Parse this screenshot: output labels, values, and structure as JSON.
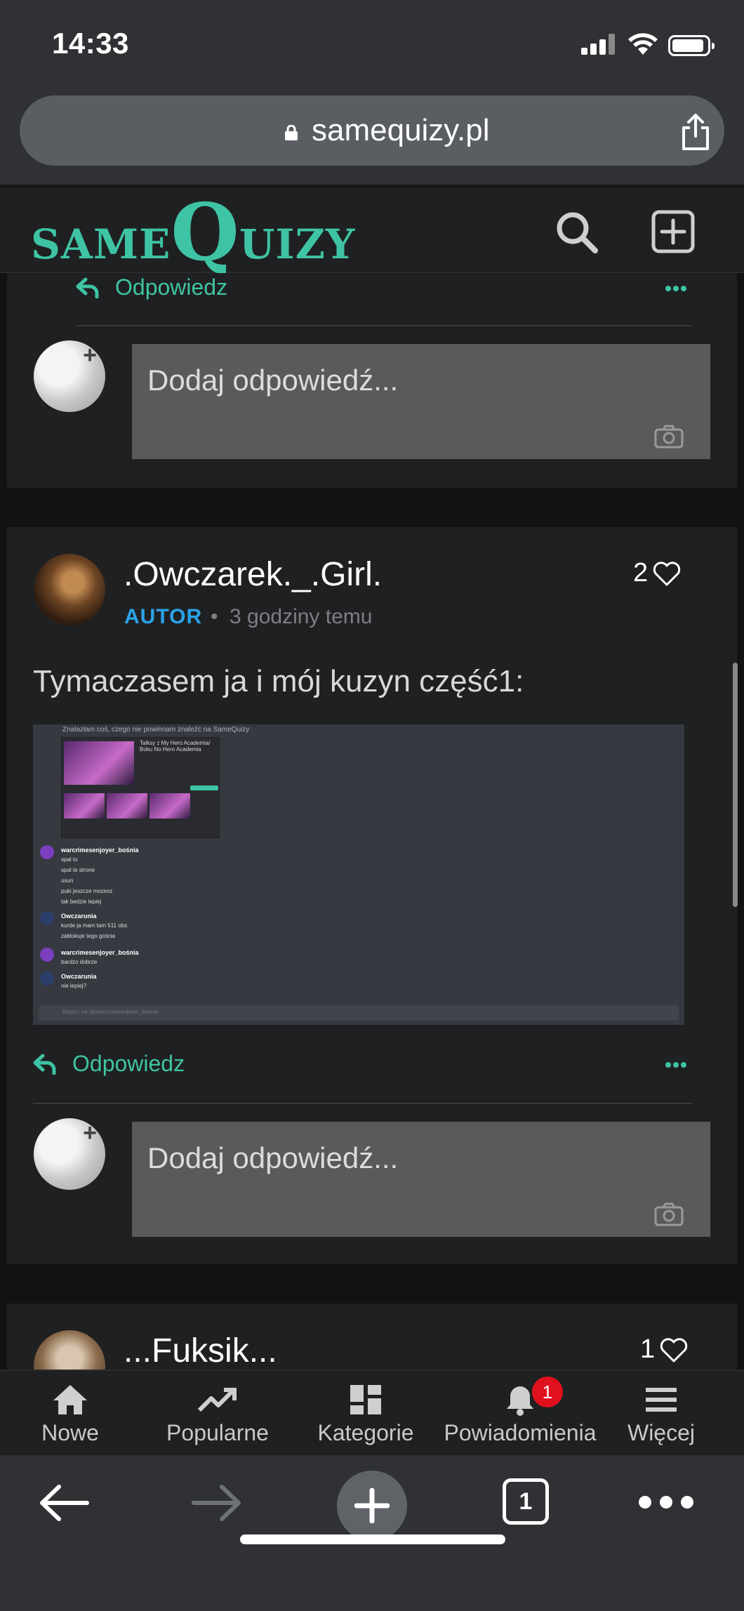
{
  "status_bar": {
    "time": "14:33"
  },
  "browser": {
    "url": "samequizy.pl"
  },
  "site": {
    "logo_same": "SAME",
    "logo_q": "Q",
    "logo_uizy": "UIZY"
  },
  "thread": {
    "top_reply_label": "Odpowiedz",
    "reply_placeholder": "Dodaj odpowiedź..."
  },
  "comments": [
    {
      "author": ".Owczarek._.Girl.",
      "badge": "AUTOR",
      "separator": "•",
      "time": "3 godziny temu",
      "likes": "2",
      "text": "Tymaczasem ja i mój kuzyn część1:",
      "reply_label": "Odpowiedz",
      "reply_placeholder": "Dodaj odpowiedź...",
      "attachment": {
        "header": "Znalazłam coś, czego nie powinnam znaleźć na SameQuizy",
        "preview_title": "Talksy z My Hero Academia/ Boku No Hero Academia",
        "messages": [
          {
            "user": "warcrimesenjoyer_bośnia",
            "lines": [
              "spal to",
              "spal te strone",
              "usun",
              "puki jeszcze mozesz",
              "tak bedzie lepiej"
            ]
          },
          {
            "user": "Owczarunia",
            "lines": [
              "kurde ja mam tam 511 obs",
              "zablokuje tego gościa"
            ]
          },
          {
            "user": "warcrimesenjoyer_bośnia",
            "lines": [
              "bardzo dobrze"
            ]
          },
          {
            "user": "Owczarunia",
            "lines": [
              "nie lepiej?"
            ]
          }
        ],
        "input_placeholder": "Napisz na @warcrimesenjoyer_bośnia"
      }
    },
    {
      "author": "...Fuksik...",
      "likes": "1"
    }
  ],
  "bottom_nav": [
    {
      "label": "Nowe",
      "icon": "home-icon"
    },
    {
      "label": "Popularne",
      "icon": "trending-icon"
    },
    {
      "label": "Kategorie",
      "icon": "grid-icon"
    },
    {
      "label": "Powiadomienia",
      "icon": "bell-icon",
      "badge": "1"
    },
    {
      "label": "Więcej",
      "icon": "menu-icon"
    }
  ],
  "toolbar": {
    "tab_count": "1"
  },
  "colors": {
    "accent": "#3ec4a4",
    "autor": "#2aa3e8",
    "badge": "#e0101e"
  }
}
